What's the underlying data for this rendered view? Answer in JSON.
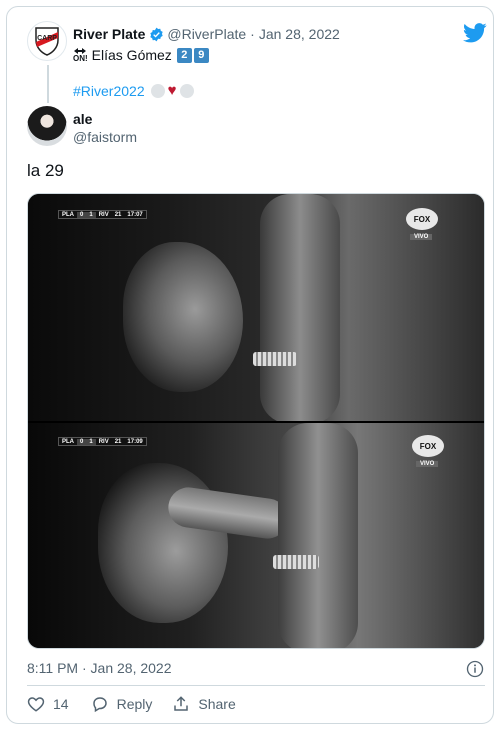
{
  "tweet": {
    "author_name": "River Plate",
    "author_handle": "@RiverPlate",
    "date": "Jan 28, 2022",
    "separator": "·",
    "bio_on": "ON!",
    "bio_name": "Elías Gómez",
    "bio_digit1": "2",
    "bio_digit2": "9",
    "hashtag": "#River2022"
  },
  "reply": {
    "name": "ale",
    "handle": "@faistorm",
    "text": "la 29"
  },
  "media": {
    "scorebug": {
      "team1": "PLA",
      "score1": "0",
      "score2": "1",
      "team2": "RIV",
      "minute1": "21",
      "time1": "17:07",
      "time2": "17:09"
    },
    "network": "FOX",
    "live": "VIVO"
  },
  "footer": {
    "timestamp": "8:11 PM · Jan 28, 2022",
    "likes": "14",
    "reply_label": "Reply",
    "share_label": "Share"
  },
  "colors": {
    "link": "#1d9bf0",
    "muted": "#536471",
    "heart": "#be1931",
    "keycap": "#3b88c3"
  },
  "icons": [
    "twitter-bird-icon",
    "verified-badge-icon",
    "on-arrow-icon",
    "heart-icon",
    "reply-bubble-icon",
    "share-icon",
    "info-icon"
  ]
}
